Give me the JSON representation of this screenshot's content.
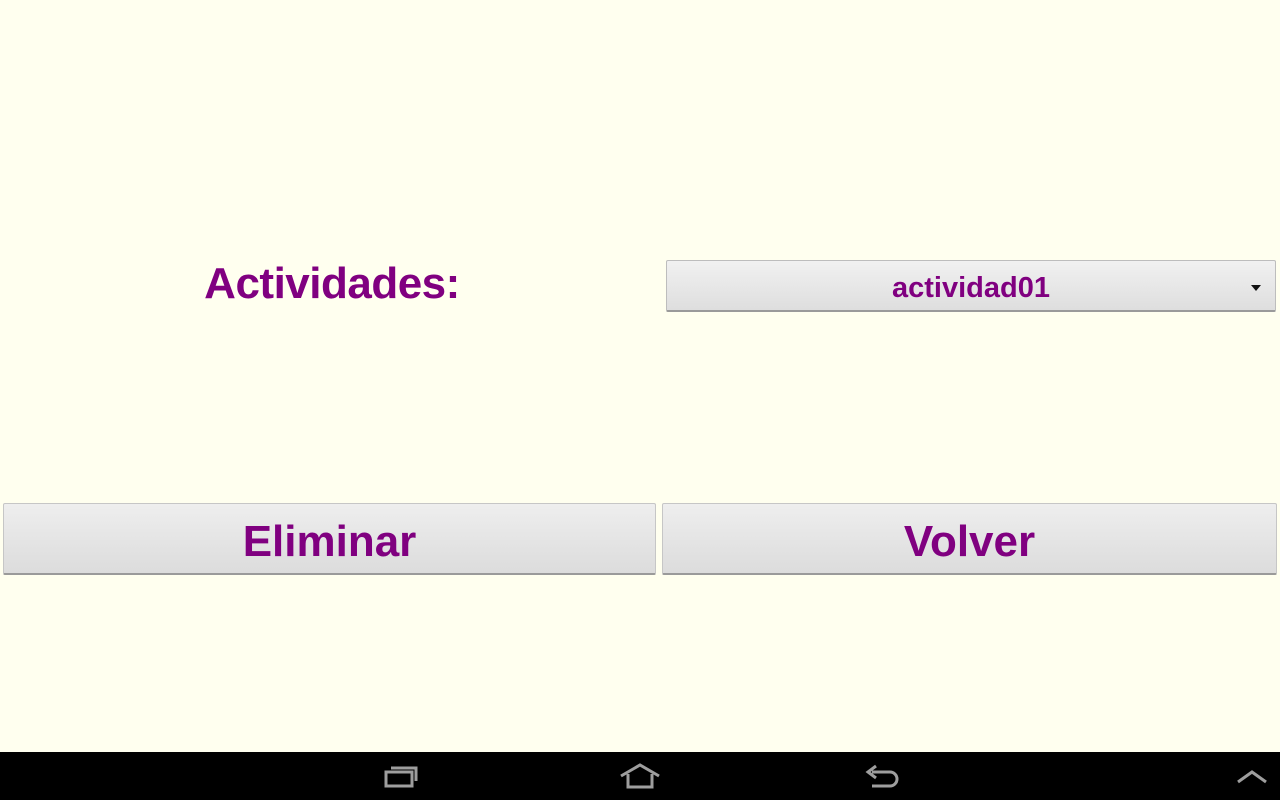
{
  "main": {
    "label": "Actividades:",
    "spinner": {
      "selected_value": "actividad01",
      "arrow_icon": "dropdown-triangle-icon"
    },
    "buttons": {
      "eliminar_label": "Eliminar",
      "volver_label": "Volver"
    }
  },
  "navbar": {
    "icons": [
      "recent-apps-icon",
      "home-icon",
      "back-icon",
      "menu-up-icon"
    ]
  },
  "colors": {
    "background": "#FFFFEF",
    "text_accent": "#800080",
    "navbar": "#000000",
    "nav_icon": "#9e9e9e"
  }
}
